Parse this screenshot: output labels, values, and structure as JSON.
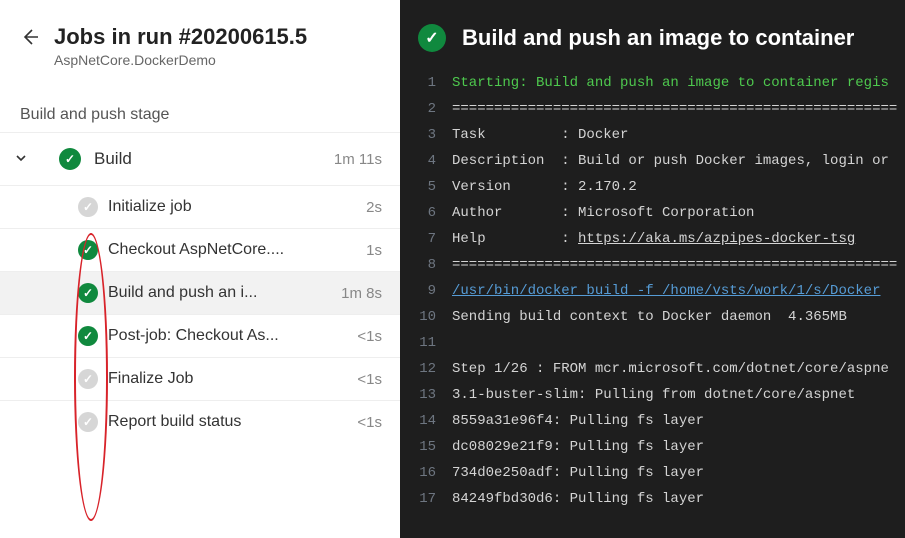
{
  "header": {
    "title": "Jobs in run #20200615.5",
    "subtitle": "AspNetCore.DockerDemo"
  },
  "stage_label": "Build and push stage",
  "job": {
    "name": "Build",
    "duration": "1m 11s",
    "status": "success"
  },
  "tasks": [
    {
      "name": "Initialize job",
      "duration": "2s",
      "status": "neutral",
      "selected": false
    },
    {
      "name": "Checkout AspNetCore....",
      "duration": "1s",
      "status": "success",
      "selected": false
    },
    {
      "name": "Build and push an i...",
      "duration": "1m 8s",
      "status": "success",
      "selected": true
    },
    {
      "name": "Post-job: Checkout As...",
      "duration": "<1s",
      "status": "success",
      "selected": false
    },
    {
      "name": "Finalize Job",
      "duration": "<1s",
      "status": "neutral",
      "selected": false
    },
    {
      "name": "Report build status",
      "duration": "<1s",
      "status": "neutral",
      "selected": false
    }
  ],
  "detail": {
    "title": "Build and push an image to container",
    "status": "success"
  },
  "log_lines": [
    {
      "n": 1,
      "text": "Starting: Build and push an image to container regis",
      "cls": "log-green"
    },
    {
      "n": 2,
      "text": "=====================================================",
      "cls": ""
    },
    {
      "n": 3,
      "text": "Task         : Docker",
      "cls": ""
    },
    {
      "n": 4,
      "text": "Description  : Build or push Docker images, login or",
      "cls": ""
    },
    {
      "n": 5,
      "text": "Version      : 2.170.2",
      "cls": ""
    },
    {
      "n": 6,
      "text": "Author       : Microsoft Corporation",
      "cls": ""
    },
    {
      "n": 7,
      "text": "Help         : ",
      "link": "https://aka.ms/azpipes-docker-tsg",
      "cls": ""
    },
    {
      "n": 8,
      "text": "=====================================================",
      "cls": ""
    },
    {
      "n": 9,
      "text": "/usr/bin/docker build -f /home/vsts/work/1/s/Docker",
      "cls": "log-blue"
    },
    {
      "n": 10,
      "text": "Sending build context to Docker daemon  4.365MB",
      "cls": ""
    },
    {
      "n": 11,
      "text": "",
      "cls": ""
    },
    {
      "n": 12,
      "text": "Step 1/26 : FROM mcr.microsoft.com/dotnet/core/aspne",
      "cls": ""
    },
    {
      "n": 13,
      "text": "3.1-buster-slim: Pulling from dotnet/core/aspnet",
      "cls": ""
    },
    {
      "n": 14,
      "text": "8559a31e96f4: Pulling fs layer",
      "cls": ""
    },
    {
      "n": 15,
      "text": "dc08029e21f9: Pulling fs layer",
      "cls": ""
    },
    {
      "n": 16,
      "text": "734d0e250adf: Pulling fs layer",
      "cls": ""
    },
    {
      "n": 17,
      "text": "84249fbd30d6: Pulling fs layer",
      "cls": ""
    }
  ]
}
